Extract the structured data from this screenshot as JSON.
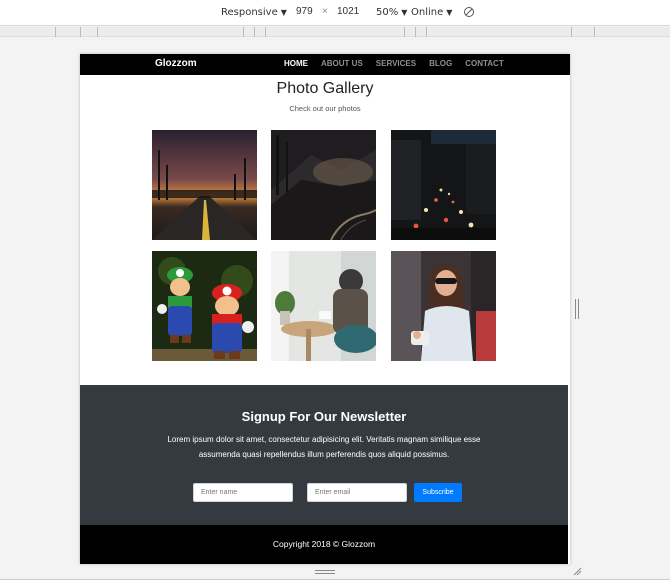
{
  "devtools": {
    "device": "Responsive",
    "width": "979",
    "times": "×",
    "height": "1021",
    "zoom": "50%",
    "network": "Online"
  },
  "site": {
    "brand": "Glozzom",
    "nav": [
      {
        "label": "HOME",
        "active": true
      },
      {
        "label": "ABOUT US",
        "active": false
      },
      {
        "label": "SERVICES",
        "active": false
      },
      {
        "label": "BLOG",
        "active": false
      },
      {
        "label": "CONTACT",
        "active": false
      }
    ],
    "gallery": {
      "title": "Photo Gallery",
      "subtitle": "Check out our photos",
      "photos": [
        "road-sunset-photo",
        "mountain-road-night-photo",
        "city-traffic-night-photo",
        "mario-luigi-toys-photo",
        "cafe-interior-photo",
        "woman-sunglasses-photo"
      ]
    },
    "newsletter": {
      "title": "Signup For Our Newsletter",
      "text": "Lorem ipsum dolor sit amet, consectetur adipisicing elit. Veritatis magnam similique esse assumenda quasi repellendus illum perferendis quos aliquid possimus.",
      "name_placeholder": "Enter name",
      "email_placeholder": "Enter email",
      "button": "Subscribe"
    },
    "footer": "Copyright 2018 © Glozzom"
  },
  "colors": {
    "navbar": "#000000",
    "newsletter_bg": "#343a40",
    "button": "#007bff"
  }
}
